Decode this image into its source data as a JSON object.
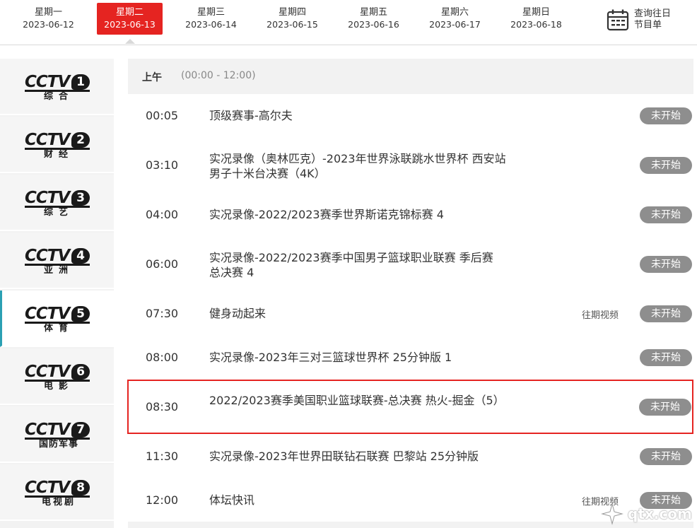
{
  "dates": [
    {
      "weekday": "星期一",
      "date": "2023-06-12"
    },
    {
      "weekday": "星期二",
      "date": "2023-06-13",
      "active": true
    },
    {
      "weekday": "星期三",
      "date": "2023-06-14"
    },
    {
      "weekday": "星期四",
      "date": "2023-06-15"
    },
    {
      "weekday": "星期五",
      "date": "2023-06-16"
    },
    {
      "weekday": "星期六",
      "date": "2023-06-17"
    },
    {
      "weekday": "星期日",
      "date": "2023-06-18"
    }
  ],
  "history": {
    "label_line1": "查询往日",
    "label_line2": "节目单",
    "icon": "calendar-icon"
  },
  "channels": [
    {
      "brand": "CCTV",
      "number": "1",
      "name": "综合"
    },
    {
      "brand": "CCTV",
      "number": "2",
      "name": "财经"
    },
    {
      "brand": "CCTV",
      "number": "3",
      "name": "综艺"
    },
    {
      "brand": "CCTV",
      "number": "4",
      "name": "亚洲"
    },
    {
      "brand": "CCTV",
      "number": "5",
      "name": "体育",
      "active": true
    },
    {
      "brand": "CCTV",
      "number": "6",
      "name": "电影"
    },
    {
      "brand": "CCTV",
      "number": "7",
      "name": "国防军事"
    },
    {
      "brand": "CCTV",
      "number": "8",
      "name": "电视剧"
    }
  ],
  "period": {
    "name": "上午",
    "range": "(00:00 - 12:00)"
  },
  "programs": [
    {
      "time": "00:05",
      "title": "顶级赛事-高尔夫",
      "status": "未开始"
    },
    {
      "time": "03:10",
      "title": "实况录像（奥林匹克）-2023年世界泳联跳水世界杯 西安站 男子十米台决赛（4K）",
      "status": "未开始"
    },
    {
      "time": "04:00",
      "title": "实况录像-2022/2023赛季世界斯诺克锦标赛 4",
      "status": "未开始"
    },
    {
      "time": "06:00",
      "title": "实况录像-2022/2023赛季中国男子篮球职业联赛 季后赛 总决赛 4",
      "status": "未开始"
    },
    {
      "time": "07:30",
      "title": "健身动起来",
      "replay": "往期视频",
      "status": "未开始"
    },
    {
      "time": "08:00",
      "title": "实况录像-2023年三对三篮球世界杯 25分钟版 1",
      "status": "未开始"
    },
    {
      "time": "08:30",
      "title": "2022/2023赛季美国职业篮球联赛-总决赛 热火-掘金（5）",
      "status": "未开始",
      "highlighted": true
    },
    {
      "time": "11:30",
      "title": "实况录像-2023年世界田联钻石联赛 巴黎站 25分钟版",
      "status": "未开始"
    },
    {
      "time": "12:00",
      "title": "体坛快讯",
      "replay": "往期视频",
      "status": "未开始"
    }
  ],
  "watermark": {
    "text": "qtx.com"
  },
  "colors": {
    "accent": "#e52421",
    "active_channel_border": "#2ba0b3",
    "status_bg": "#8e8e8e"
  }
}
